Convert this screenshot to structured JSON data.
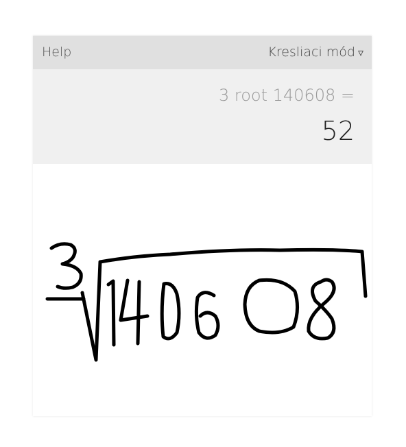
{
  "toolbar": {
    "help_label": "Help",
    "mode_label": "Kresliaci mód",
    "mode_caret": "▿"
  },
  "display": {
    "expression": "3 root 140608 =",
    "result": "52"
  },
  "canvas": {
    "ink_color": "#000000",
    "background": "#ffffff"
  },
  "colors": {
    "topbar_bg": "#e0e0e0",
    "result_bg": "#f0f0f0"
  }
}
